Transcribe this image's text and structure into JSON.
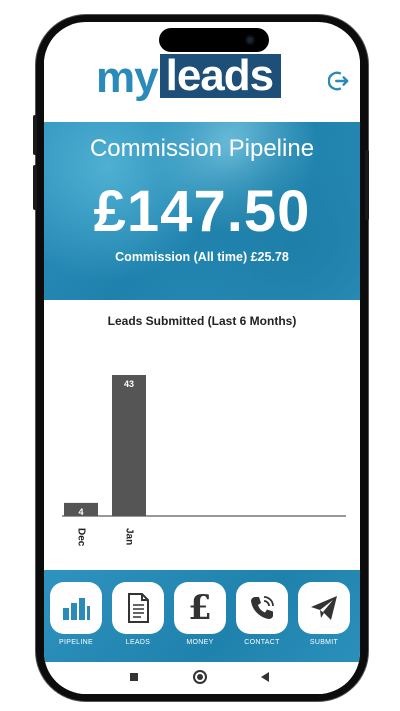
{
  "brand": {
    "logo_my": "my",
    "logo_leads": "leads",
    "primary_color": "#1f82ad",
    "dark_color": "#1d4f78"
  },
  "header": {
    "logout_icon": "logout-icon"
  },
  "hero": {
    "title": "Commission Pipeline",
    "amount": "£147.50",
    "subtitle": "Commission (All time) £25.78"
  },
  "chart_data": {
    "type": "bar",
    "title": "Leads Submitted (Last 6 Months)",
    "categories": [
      "Dec",
      "Jan"
    ],
    "values": [
      4,
      43
    ],
    "bar_color": "#555555"
  },
  "nav": {
    "items": [
      {
        "label": "PIPELINE",
        "icon": "bar-chart-icon"
      },
      {
        "label": "LEADS",
        "icon": "document-icon"
      },
      {
        "label": "MONEY",
        "icon": "pound-icon"
      },
      {
        "label": "CONTACT",
        "icon": "phone-icon"
      },
      {
        "label": "SUBMIT",
        "icon": "paper-plane-icon"
      }
    ]
  },
  "system_nav": [
    "recents-icon",
    "home-icon",
    "back-icon"
  ]
}
